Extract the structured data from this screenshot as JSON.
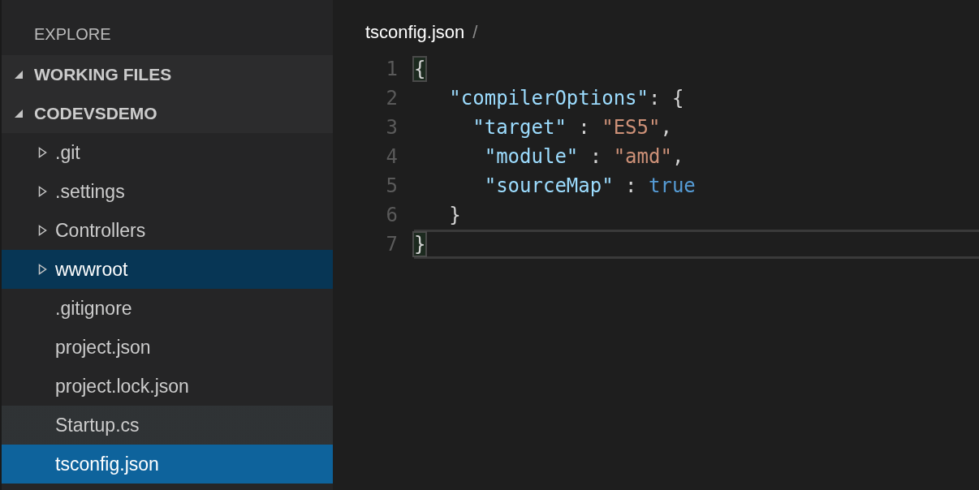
{
  "sidebar": {
    "title": "EXPLORE",
    "sections": [
      {
        "label": "WORKING FILES",
        "expanded": true
      },
      {
        "label": "CODEVSDEMO",
        "expanded": true
      }
    ],
    "items": [
      {
        "label": ".git",
        "kind": "folder",
        "selected": false,
        "focused": false,
        "hovered": false
      },
      {
        "label": ".settings",
        "kind": "folder",
        "selected": false,
        "focused": false,
        "hovered": false
      },
      {
        "label": "Controllers",
        "kind": "folder",
        "selected": false,
        "focused": false,
        "hovered": false
      },
      {
        "label": "wwwroot",
        "kind": "folder",
        "selected": true,
        "focused": false,
        "hovered": false
      },
      {
        "label": ".gitignore",
        "kind": "file",
        "selected": false,
        "focused": false,
        "hovered": false
      },
      {
        "label": "project.json",
        "kind": "file",
        "selected": false,
        "focused": false,
        "hovered": false
      },
      {
        "label": "project.lock.json",
        "kind": "file",
        "selected": false,
        "focused": false,
        "hovered": false
      },
      {
        "label": "Startup.cs",
        "kind": "file",
        "selected": false,
        "focused": false,
        "hovered": true
      },
      {
        "label": "tsconfig.json",
        "kind": "file",
        "selected": true,
        "focused": true,
        "hovered": false
      }
    ]
  },
  "editor": {
    "breadcrumb": "tsconfig.json",
    "separator": "/",
    "lines": [
      {
        "number": "1",
        "current": false,
        "tokens": [
          {
            "text": "{",
            "kind": "bracket-match"
          }
        ]
      },
      {
        "number": "2",
        "current": false,
        "tokens": [
          {
            "text": "   \"compilerOptions\"",
            "kind": "key"
          },
          {
            "text": ": {",
            "kind": "punct"
          }
        ]
      },
      {
        "number": "3",
        "current": false,
        "tokens": [
          {
            "text": "     \"target\"",
            "kind": "key"
          },
          {
            "text": " : ",
            "kind": "punct"
          },
          {
            "text": "\"ES5\"",
            "kind": "string"
          },
          {
            "text": ",",
            "kind": "punct"
          }
        ]
      },
      {
        "number": "4",
        "current": false,
        "tokens": [
          {
            "text": "      \"module\"",
            "kind": "key"
          },
          {
            "text": " : ",
            "kind": "punct"
          },
          {
            "text": "\"amd\"",
            "kind": "string"
          },
          {
            "text": ",",
            "kind": "punct"
          }
        ]
      },
      {
        "number": "5",
        "current": false,
        "tokens": [
          {
            "text": "      \"sourceMap\"",
            "kind": "key"
          },
          {
            "text": " : ",
            "kind": "punct"
          },
          {
            "text": "true",
            "kind": "keyword"
          }
        ]
      },
      {
        "number": "6",
        "current": false,
        "tokens": [
          {
            "text": "   }",
            "kind": "punct"
          }
        ]
      },
      {
        "number": "7",
        "current": true,
        "tokens": [
          {
            "text": "}",
            "kind": "bracket-match"
          }
        ]
      }
    ]
  }
}
